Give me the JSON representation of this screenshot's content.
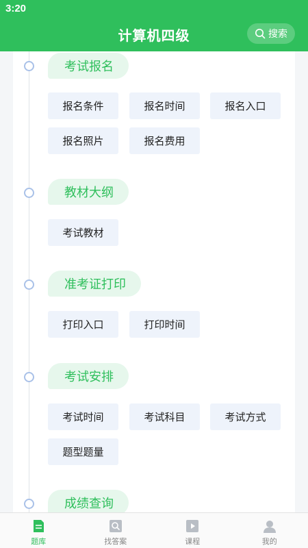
{
  "status_bar": {
    "time": "3:20"
  },
  "header": {
    "title": "计算机四级",
    "search_label": "搜索"
  },
  "sections": [
    {
      "title": "考试报名",
      "items": [
        "报名条件",
        "报名时间",
        "报名入口",
        "报名照片",
        "报名费用"
      ]
    },
    {
      "title": "教材大纲",
      "items": [
        "考试教材"
      ]
    },
    {
      "title": "准考证打印",
      "items": [
        "打印入口",
        "打印时间"
      ]
    },
    {
      "title": "考试安排",
      "items": [
        "考试时间",
        "考试科目",
        "考试方式",
        "题型题量"
      ]
    },
    {
      "title": "成绩查询",
      "items": []
    }
  ],
  "bottom_nav": [
    {
      "label": "题库",
      "icon": "question-bank-icon",
      "active": true
    },
    {
      "label": "找答案",
      "icon": "find-answer-icon",
      "active": false
    },
    {
      "label": "课程",
      "icon": "course-play-icon",
      "active": false
    },
    {
      "label": "我的",
      "icon": "profile-icon",
      "active": false
    }
  ],
  "colors": {
    "brand": "#2fbf5c",
    "chip_bg": "#eef3fb",
    "title_bg": "#e6f7ec"
  }
}
